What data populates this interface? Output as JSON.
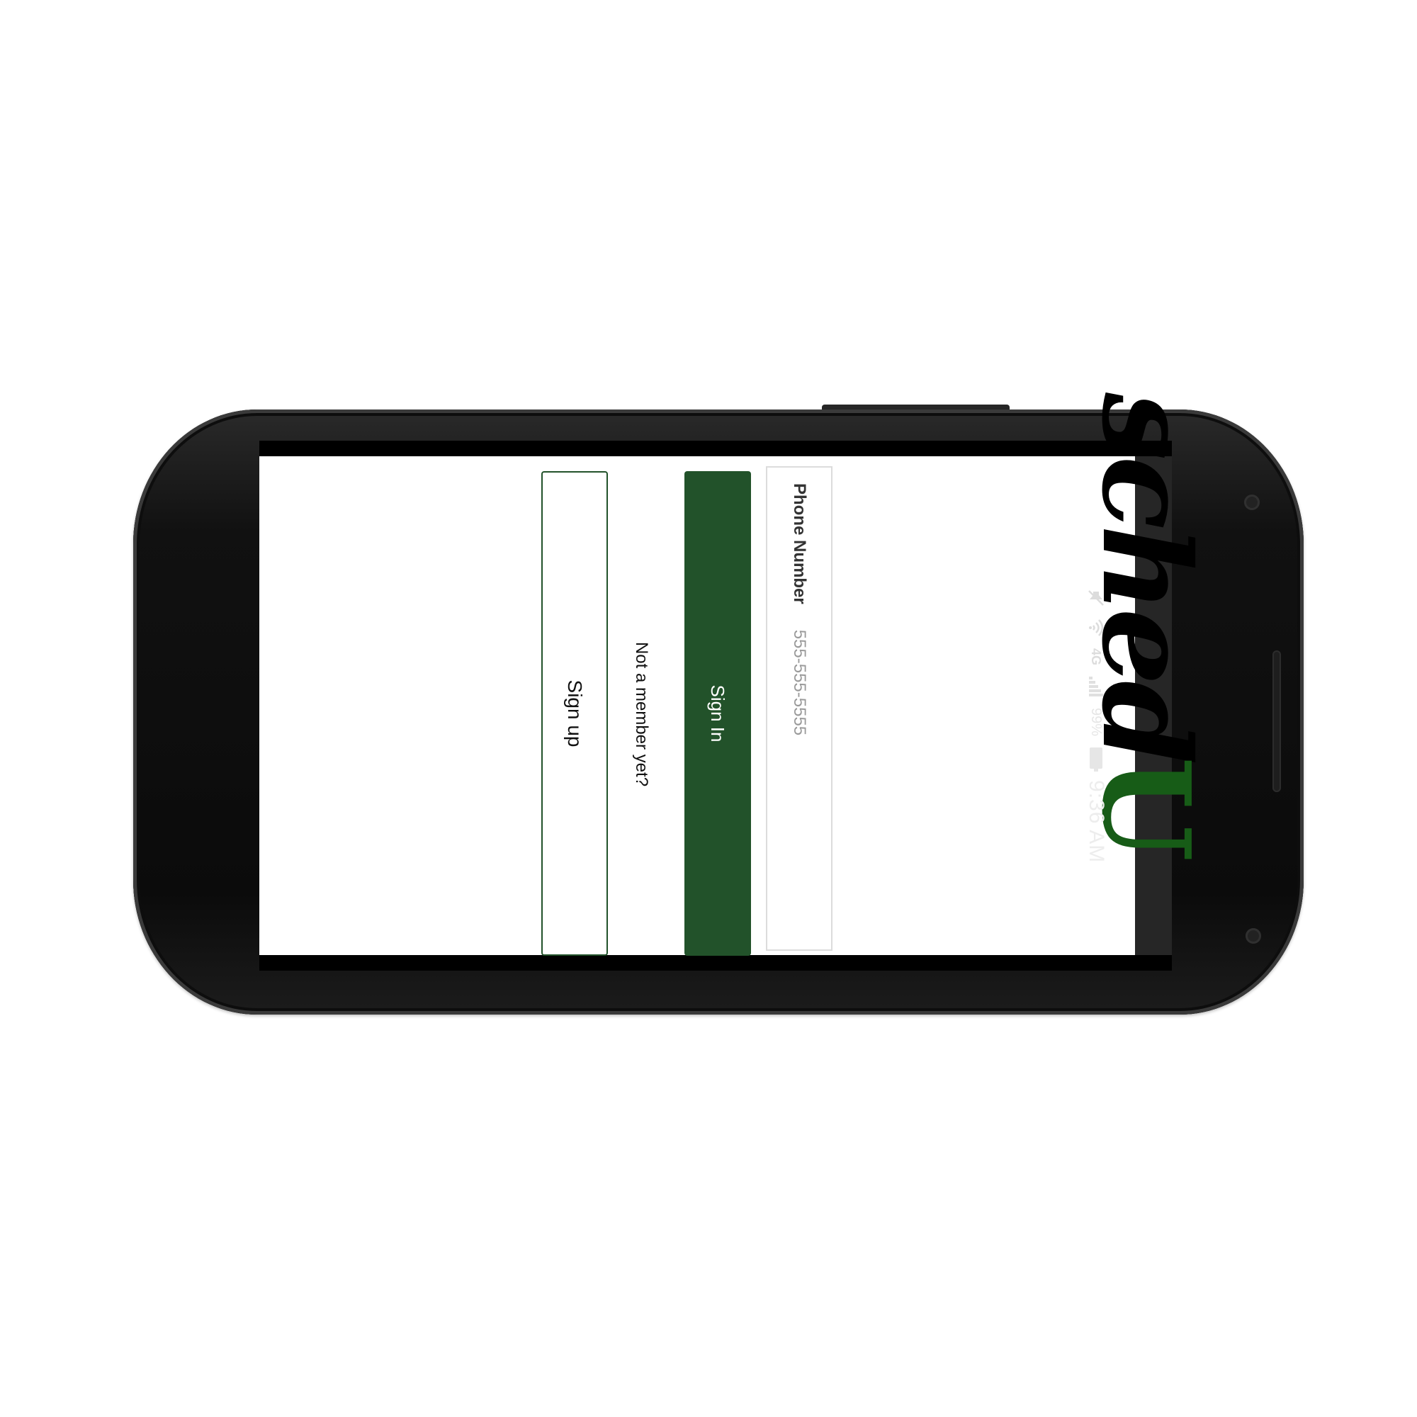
{
  "app": {
    "logo_script": "sched",
    "logo_u": "U"
  },
  "login": {
    "phone_label": "Phone Number",
    "phone_placeholder": "555-555-5555",
    "sign_in_label": "Sign In",
    "member_prompt": "Not a member yet?",
    "sign_up_label": "Sign up"
  },
  "status_bar": {
    "time": "9:36 AM",
    "battery": "99%",
    "network": "4G",
    "icons": [
      "mute-icon",
      "wifi-icon",
      "lte-icon",
      "signal-icon",
      "battery-icon"
    ]
  },
  "colors": {
    "brand_green": "#22522a",
    "logo_green": "#175c17",
    "status_bar_bg": "#262626"
  }
}
